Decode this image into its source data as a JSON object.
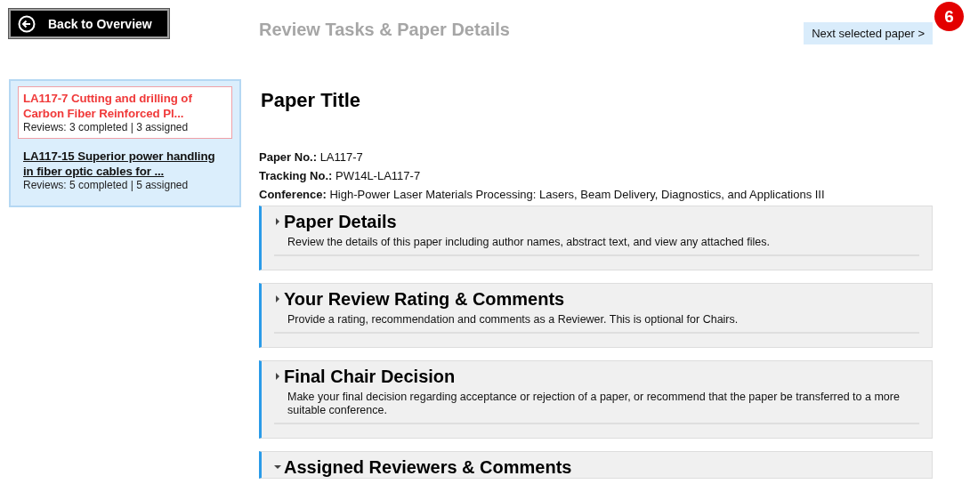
{
  "back_button": {
    "label": "Back to Overview"
  },
  "page_title": "Review Tasks & Paper Details",
  "next_button": {
    "label": "Next selected paper >"
  },
  "badge": "6",
  "papers": [
    {
      "title": "LA117-7 Cutting and drilling of Carbon Fiber Reinforced Pl...",
      "reviews": "Reviews: 3 completed | 3 assigned",
      "selected": true
    },
    {
      "title": "LA117-15 Superior power handling in fiber optic cables for ...",
      "reviews": "Reviews: 5 completed | 5 assigned",
      "selected": false
    }
  ],
  "paper_heading": "Paper Title",
  "details": [
    {
      "label": "Paper No.:",
      "value": "LA117-7"
    },
    {
      "label": "Tracking No.:",
      "value": "PW14L-LA117-7"
    },
    {
      "label": "Conference:",
      "value": "High-Power Laser Materials Processing: Lasers, Beam Delivery, Diagnostics, and Applications III"
    }
  ],
  "sections": [
    {
      "title": "Paper Details",
      "description": "Review the details of this paper including author names, abstract text, and view any attached files.",
      "expanded": false
    },
    {
      "title": "Your Review Rating & Comments",
      "description": "Provide a rating, recommendation and comments as a Reviewer. This is optional for Chairs.",
      "expanded": false
    },
    {
      "title": "Final Chair Decision",
      "description": "Make your final decision regarding acceptance or rejection of a paper, or recommend that the paper be transferred to a more suitable conference.",
      "expanded": false
    },
    {
      "title": "Assigned Reviewers & Comments",
      "expanded": true
    }
  ]
}
